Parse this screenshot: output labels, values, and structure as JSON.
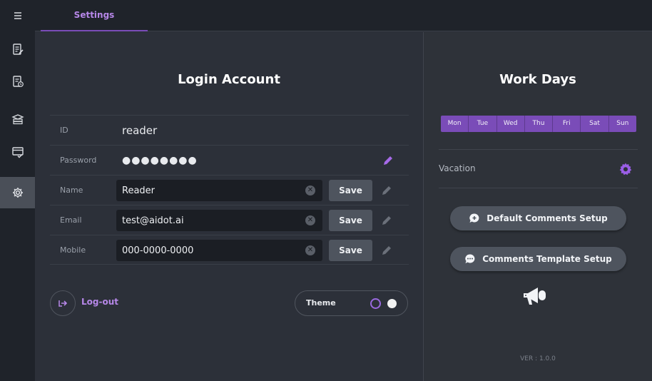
{
  "tabs": [
    {
      "label": "Settings",
      "active": true
    }
  ],
  "sidebar": {
    "items": [
      {
        "icon": "menu-icon"
      },
      {
        "icon": "edit-document-icon"
      },
      {
        "icon": "document-clock-icon"
      },
      {
        "icon": "graduation-cap-icon"
      },
      {
        "icon": "card-check-icon"
      },
      {
        "icon": "gear-icon",
        "active": true
      }
    ]
  },
  "login": {
    "title": "Login Account",
    "id": {
      "label": "ID",
      "value": "reader"
    },
    "password": {
      "label": "Password",
      "value": "●●●●●●●●"
    },
    "name": {
      "label": "Name",
      "value": "Reader",
      "save_label": "Save"
    },
    "email": {
      "label": "Email",
      "value": "test@aidot.ai",
      "save_label": "Save"
    },
    "mobile": {
      "label": "Mobile",
      "value": "000-0000-0000",
      "save_label": "Save"
    },
    "logout_label": "Log-out",
    "theme_label": "Theme"
  },
  "workdays": {
    "title": "Work Days",
    "days": [
      "Mon",
      "Tue",
      "Wed",
      "Thu",
      "Fri",
      "Sat",
      "Sun"
    ],
    "vacation_label": "Vacation",
    "default_comments_label": "Default Comments Setup",
    "comments_template_label": "Comments Template Setup",
    "version": "VER : 1.0.0"
  },
  "colors": {
    "accent": "#7a4cb8",
    "accent_text": "#b687e8",
    "background": "#2c3039",
    "sidebar": "#1f232a"
  }
}
